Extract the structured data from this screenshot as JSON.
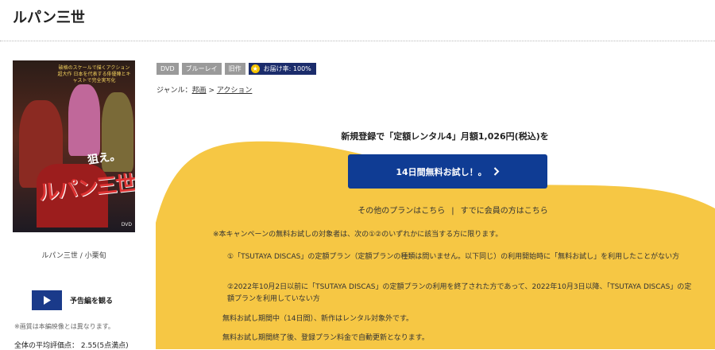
{
  "page": {
    "title": "ルパン三世"
  },
  "product": {
    "cover_banner": "破格のスケールで描くアクション超大作 日本を代表する俳優陣とキャストで完全実写化",
    "cover_tagline": "狙え。",
    "cover_logo": "ルパン三世",
    "cover_dvd_mark": "DVD",
    "caption": "ルパン三世 / 小栗旬",
    "badges": [
      "DVD",
      "ブルーレイ",
      "旧作"
    ],
    "delivery_label": "お届け率: 100%",
    "genre_label": "ジャンル：",
    "genre_category": "邦画",
    "genre_sep": " > ",
    "genre_sub": "アクション",
    "trailer_label": "予告編を観る",
    "note": "※画質は本編映像とは異なります。",
    "rating": "全体の平均評価点： 2.55(5点満点)"
  },
  "promo": {
    "heading": "新規登録で「定額レンタル4」月額1,026円(税込)を",
    "trial_button": "14日間無料お試し！。",
    "other_plans": "その他のプランはこちら",
    "link_separator": "|",
    "member_link": "すでに会員の方はこちら",
    "terms": [
      "※本キャンペーンの無料お試しの対象者は、次の①②のいずれかに該当する方に限ります。",
      "①「TSUTAYA DISCAS」の定額プラン（定額プランの種類は問いません。以下同じ）の利用開始時に「無料お試し」を利用したことがない方",
      "②2022年10月2日以前に「TSUTAYA DISCAS」の定額プランの利用を終了された方であって、2022年10月3日以降、「TSUTAYA DISCAS」の定額プランを利用していない方",
      "無料お試し期間中（14日間）、新作はレンタル対象外です。",
      "無料お試し期間終了後、登録プラン料金で自動更新となります。"
    ]
  },
  "colors": {
    "accent_yellow": "#F6C744",
    "button_blue": "#0F3C94",
    "badge_gray": "#9A9A9A",
    "badge_navy": "#1B2C6B"
  }
}
